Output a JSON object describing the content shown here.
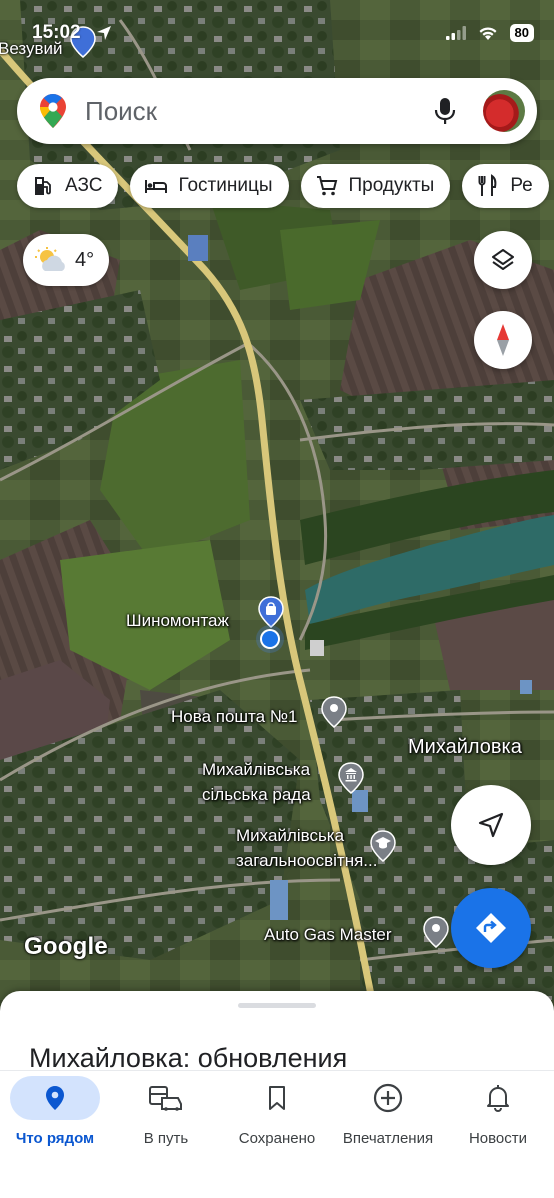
{
  "status_bar": {
    "time": "15:02",
    "battery": "80"
  },
  "map": {
    "labels": {
      "top_city": "Везувий",
      "tire_shop": "Шиномонтаж",
      "nova_poshta": "Нова пошта №1",
      "village": "Михайловка",
      "council_line1": "Михайлівська",
      "council_line2": "сільська рада",
      "school_line1": "Михайлівська",
      "school_line2": "загальноосвітня...",
      "gas": "Auto Gas Master"
    },
    "logo": "Google"
  },
  "search": {
    "placeholder": "Поиск"
  },
  "chips": [
    {
      "label": "АЗС",
      "icon": "gas-station-icon"
    },
    {
      "label": "Гостиницы",
      "icon": "bed-icon"
    },
    {
      "label": "Продукты",
      "icon": "cart-icon"
    },
    {
      "label": "Ре",
      "icon": "restaurant-icon"
    }
  ],
  "weather": {
    "temp": "4°",
    "icon": "partly-cloudy-icon"
  },
  "sheet": {
    "title": "Михайловка: обновления"
  },
  "tabs": [
    {
      "label": "Что рядом",
      "icon": "location-pin-icon",
      "active": true
    },
    {
      "label": "В путь",
      "icon": "commute-icon",
      "active": false
    },
    {
      "label": "Сохранено",
      "icon": "bookmark-icon",
      "active": false
    },
    {
      "label": "Впечатления",
      "icon": "add-circle-icon",
      "active": false
    },
    {
      "label": "Новости",
      "icon": "bell-icon",
      "active": false
    }
  ],
  "colors": {
    "accent": "#1a73e8",
    "active_tab_bg": "#d3e3fd",
    "active_tab_text": "#0b57d0"
  }
}
